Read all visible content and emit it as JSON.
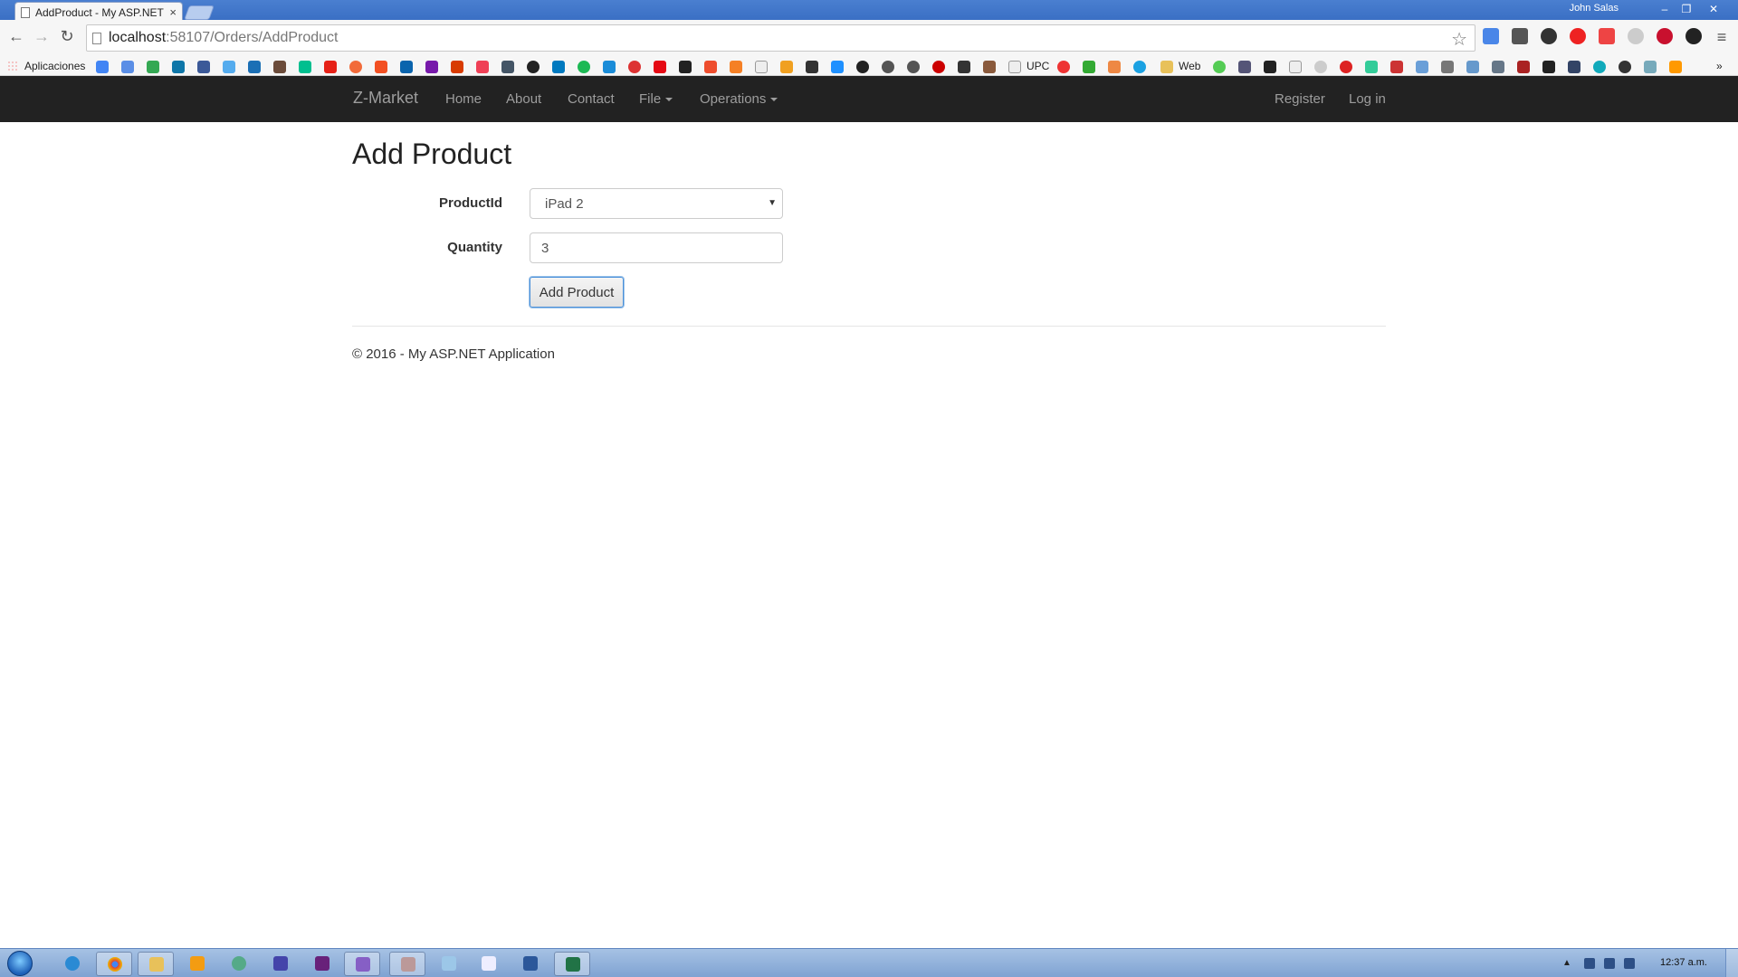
{
  "browser": {
    "tab_title": "AddProduct - My ASP.NET",
    "user_name": "John Salas",
    "url_host": "localhost",
    "url_path": ":58107/Orders/AddProduct",
    "bookmarks_apps_label": "Aplicaciones",
    "bookmark_labels": [
      "UPC",
      "Web"
    ]
  },
  "navbar": {
    "brand": "Z-Market",
    "links": [
      "Home",
      "About",
      "Contact",
      "File",
      "Operations"
    ],
    "right_links": [
      "Register",
      "Log in"
    ]
  },
  "page": {
    "title": "Add Product",
    "form": {
      "product_label": "ProductId",
      "product_value": "iPad 2",
      "quantity_label": "Quantity",
      "quantity_value": "3",
      "submit_label": "Add Product"
    },
    "footer": "© 2016 - My ASP.NET Application"
  },
  "taskbar": {
    "clock": "12:37 a.m."
  },
  "colors": {
    "navbar_bg": "#222222",
    "nav_text": "#9d9d9d",
    "focus_border": "#4a90d9"
  }
}
